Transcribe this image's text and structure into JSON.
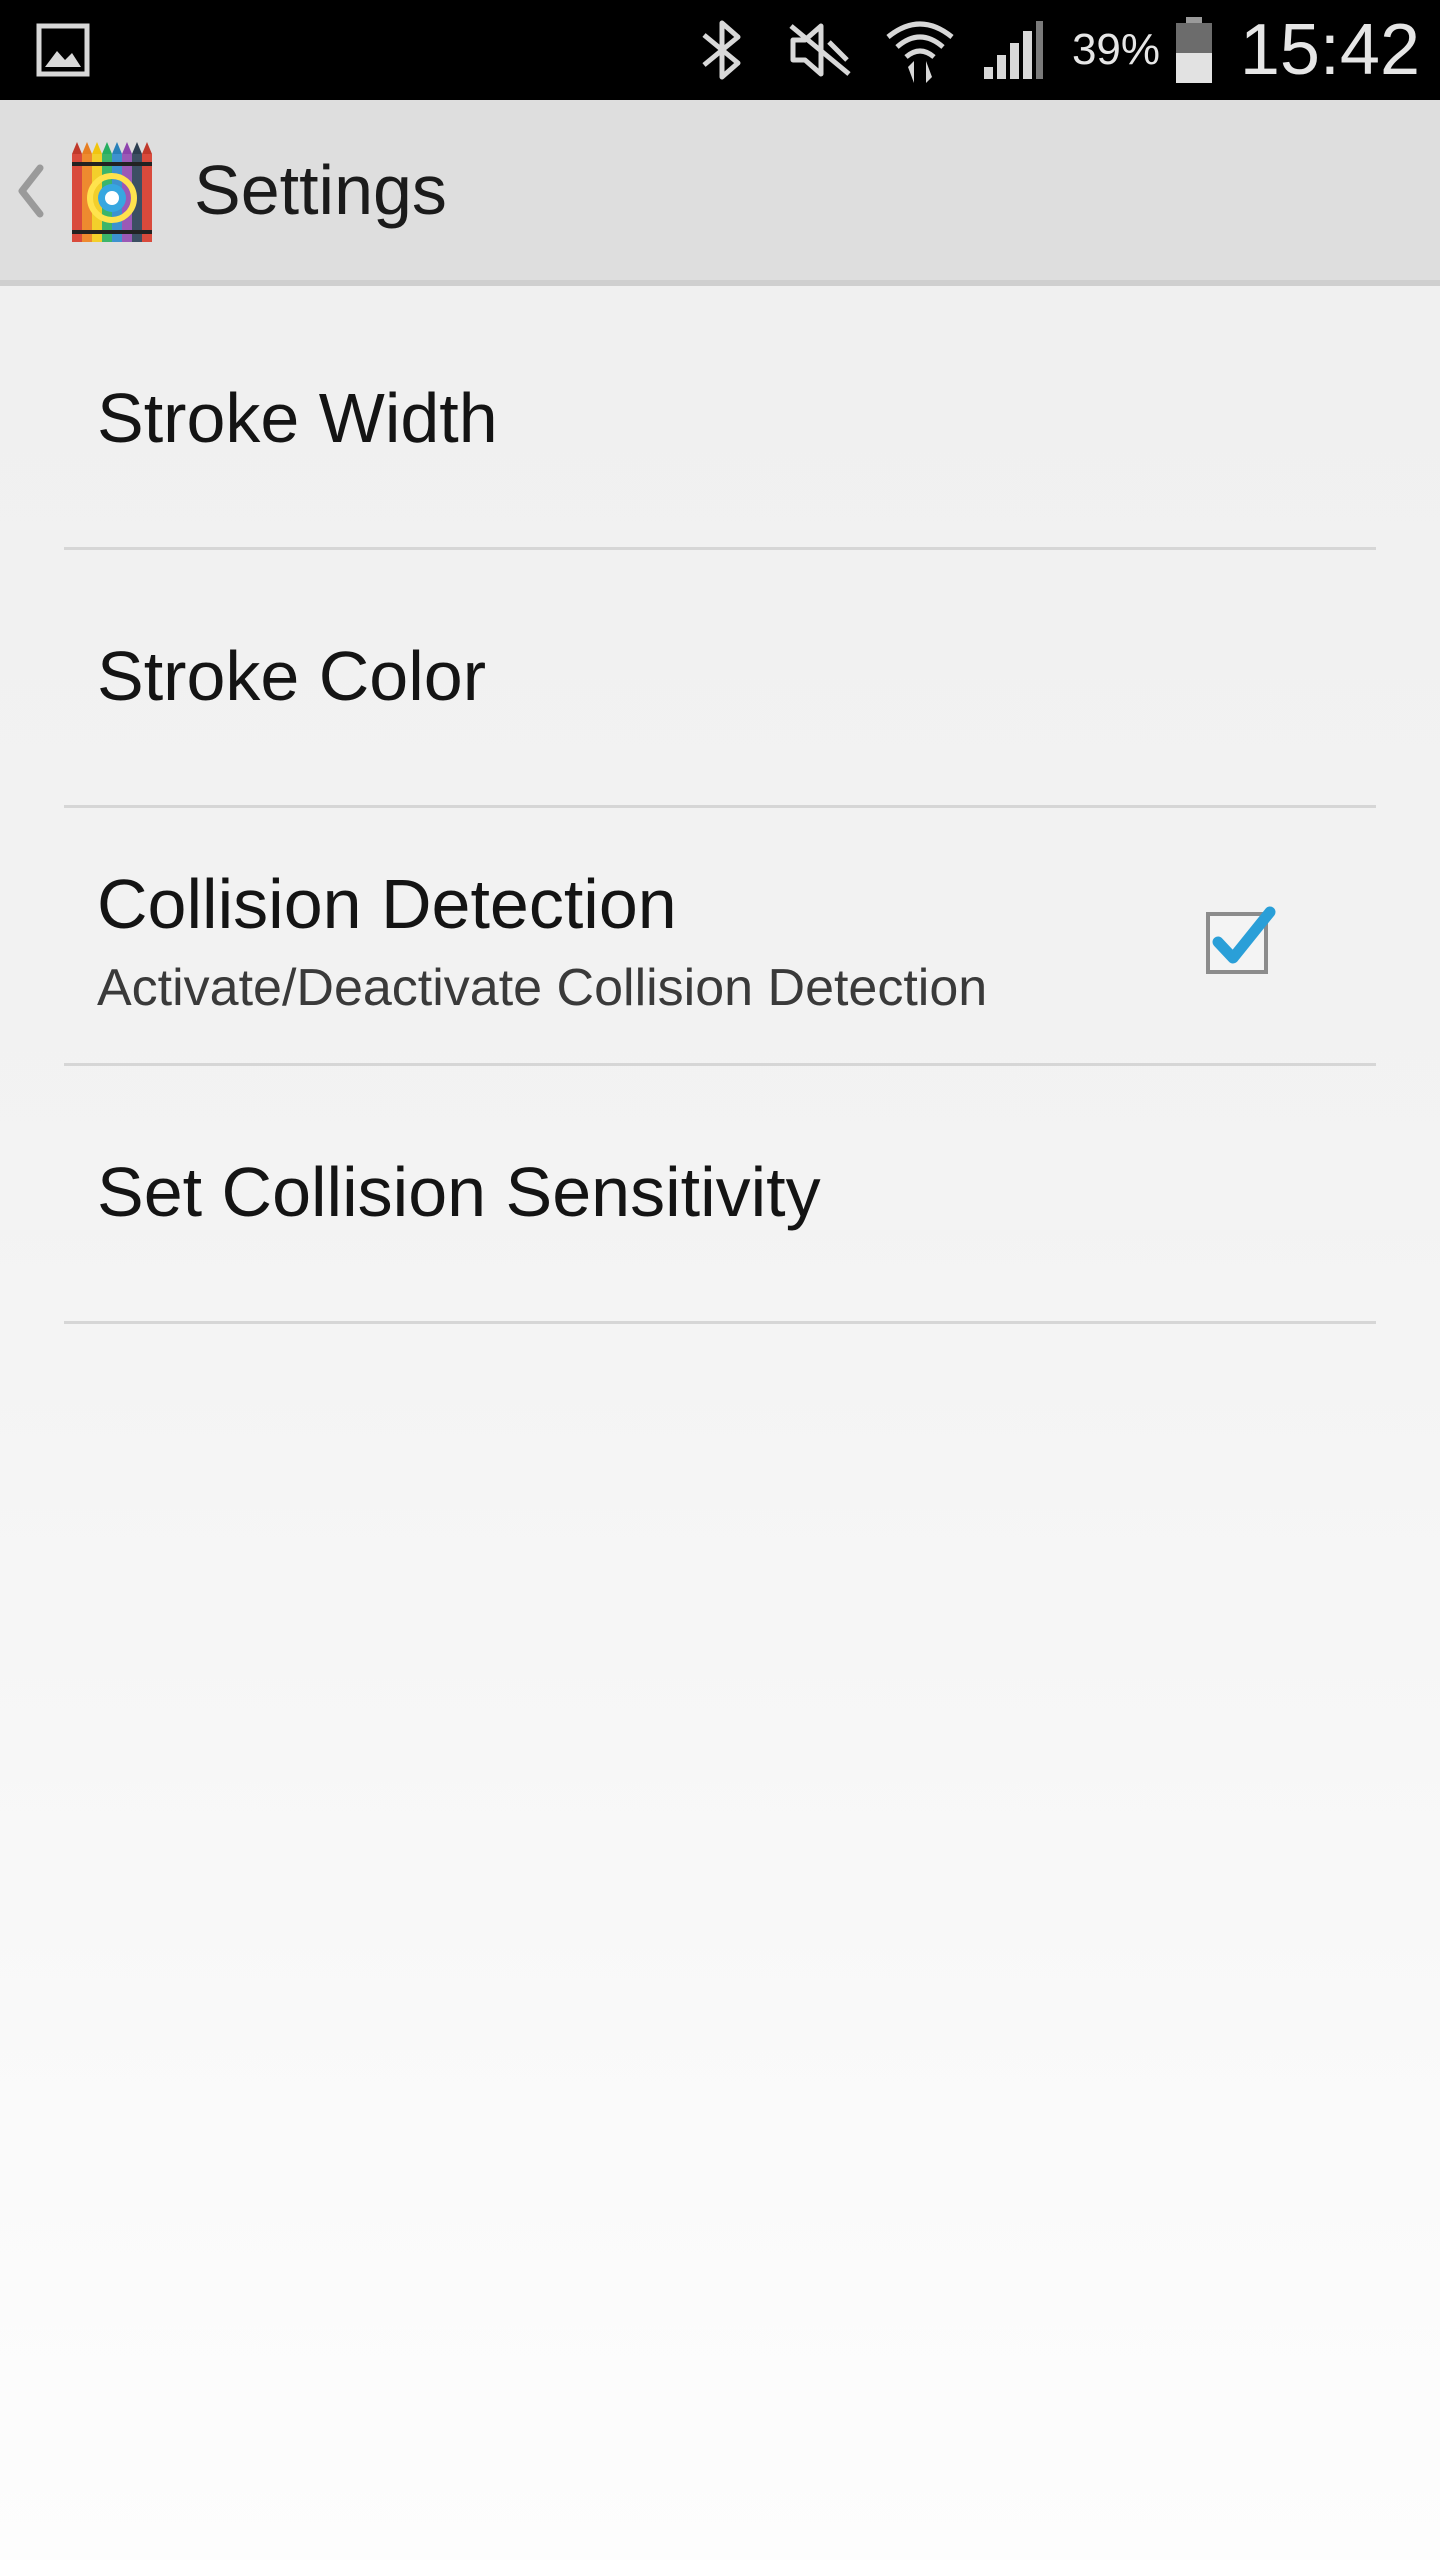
{
  "status_bar": {
    "left_icons": [
      "gallery-icon"
    ],
    "right_icons": [
      "bluetooth-icon",
      "mute-icon",
      "wifi-icon",
      "signal-icon",
      "battery-icon"
    ],
    "battery_percent": "39%",
    "time": "15:42"
  },
  "action_bar": {
    "title": "Settings",
    "app_icon": "crayon-box-icon",
    "up_icon": "chevron-left-icon"
  },
  "preferences": [
    {
      "title": "Stroke Width",
      "summary": ""
    },
    {
      "title": "Stroke Color",
      "summary": ""
    },
    {
      "title": "Collision Detection",
      "summary": "Activate/Deactivate Collision Detection",
      "checked": true
    },
    {
      "title": "Set Collision Sensitivity",
      "summary": ""
    }
  ],
  "colors": {
    "status_bar_bg": "#000000",
    "action_bar_bg": "#dedede",
    "checkbox_accent": "#2a9fd8",
    "divider": "#d6d6d6"
  }
}
